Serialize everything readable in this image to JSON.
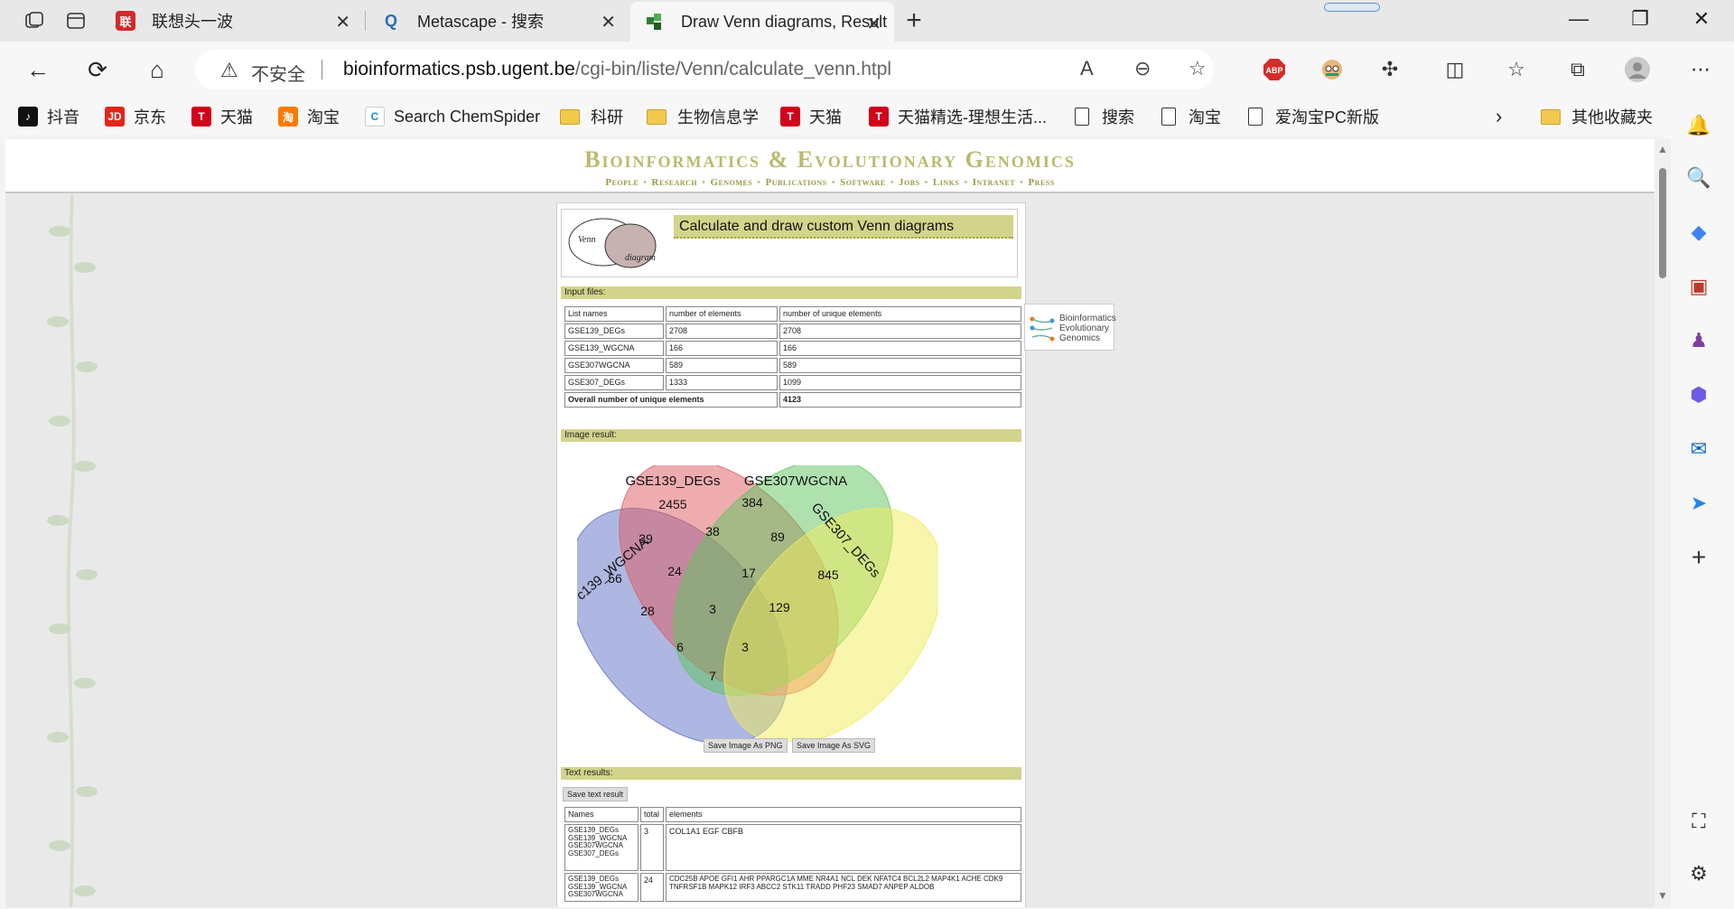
{
  "browser": {
    "tabs": [
      {
        "title": "联想头一波",
        "fav_text": "联",
        "fav_color": "#d42a2a"
      },
      {
        "title": "Metascape - 搜索",
        "fav_text": "Q",
        "fav_color": "#2b6cb0"
      },
      {
        "title": "Draw Venn diagrams, Result",
        "fav_text": "",
        "fav_color": "#2f7d32"
      }
    ],
    "address": {
      "insecure_label": "不安全",
      "host": "bioinformatics.psb.ugent.be",
      "path": "/cgi-bin/liste/Venn/calculate_venn.htpl"
    },
    "extensions": {
      "abp": "ABP"
    },
    "bookmarks": [
      {
        "label": "抖音",
        "kind": "icon",
        "icon": "tiktok-icon",
        "color": "#111111",
        "glyph": "♪"
      },
      {
        "label": "京东",
        "kind": "icon",
        "icon": "jd-icon",
        "color": "#e1251b",
        "glyph": "JD"
      },
      {
        "label": "天猫",
        "kind": "icon",
        "icon": "tmall-icon",
        "color": "#d3001b",
        "glyph": "T"
      },
      {
        "label": "淘宝",
        "kind": "icon",
        "icon": "taobao-icon",
        "color": "#ff7a00",
        "glyph": "淘"
      },
      {
        "label": "Search ChemSpider",
        "kind": "icon",
        "icon": "chemspider-icon",
        "color": "#ffffff",
        "glyph": "C"
      },
      {
        "label": "科研",
        "kind": "folder"
      },
      {
        "label": "生物信息学",
        "kind": "folder"
      },
      {
        "label": "天猫",
        "kind": "icon",
        "icon": "tmall-icon",
        "color": "#d3001b",
        "glyph": "T"
      },
      {
        "label": "天猫精选-理想生活...",
        "kind": "icon",
        "icon": "tmall-icon",
        "color": "#d3001b",
        "glyph": "T"
      },
      {
        "label": "搜索",
        "kind": "page"
      },
      {
        "label": "淘宝",
        "kind": "page"
      },
      {
        "label": "爱淘宝PC新版",
        "kind": "page"
      }
    ],
    "other_bookmarks": "其他收藏夹"
  },
  "site": {
    "title": "Bioinformatics & Evolutionary Genomics",
    "nav": [
      "People",
      "Research",
      "Genomes",
      "Publications",
      "Software",
      "Jobs",
      "Links",
      "Intranet",
      "Press"
    ],
    "beg_logo": [
      "Bioinformatics",
      "Evolutionary",
      "Genomics"
    ]
  },
  "page": {
    "heading": "Calculate and draw custom Venn diagrams",
    "logo_words": [
      "Venn",
      "diagram"
    ],
    "input_files_label": "Input files:",
    "input_table": {
      "headers": [
        "List names",
        "number of elements",
        "number of unique elements"
      ],
      "rows": [
        [
          "GSE139_DEGs",
          "2708",
          "2708"
        ],
        [
          "GSE139_WGCNA",
          "166",
          "166"
        ],
        [
          "GSE307WGCNA",
          "589",
          "589"
        ],
        [
          "GSE307_DEGs",
          "1333",
          "1099"
        ]
      ],
      "overall_label": "Overall number of unique elements",
      "overall_value": "4123"
    },
    "image_result_label": "Image result:",
    "save_png": "Save Image As PNG",
    "save_svg": "Save Image As SVG",
    "text_results_label": "Text results:",
    "save_text": "Save text result",
    "text_table": {
      "headers": [
        "Names",
        "total",
        "elements"
      ],
      "rows": [
        {
          "names": [
            "GSE139_DEGs",
            "GSE139_WGCNA",
            "GSE307WGCNA",
            "GSE307_DEGs"
          ],
          "total": "3",
          "elements": "COL1A1 EGF CBFB"
        },
        {
          "names": [
            "GSE139_DEGs",
            "GSE139_WGCNA",
            "GSE307WGCNA"
          ],
          "total": "24",
          "elements": "CDC25B APOE GFI1 AHR PPARGC1A MME NR4A1 NCL DEK NFATC4 BCL2L2 MAP4K1 ACHE CDK9 TNFRSF1B MAPK12 IRF3 ABCC2 STK11 TRADD PHF23 SMAD7 ANPEP ALDOB"
        }
      ]
    }
  },
  "chart_data": {
    "type": "venn",
    "sets": [
      {
        "name": "GSE139_WGCNA",
        "color": "#5b6fc4",
        "label_shown": "c139_WGCNA"
      },
      {
        "name": "GSE139_DEGs",
        "color": "#e05a5f"
      },
      {
        "name": "GSE307WGCNA",
        "color": "#5ec45e"
      },
      {
        "name": "GSE307_DEGs",
        "color": "#f2ec5a",
        "label_shown": "GSE307_DEGs"
      }
    ],
    "regions": [
      {
        "sets": [
          "GSE139_WGCNA"
        ],
        "value": 56
      },
      {
        "sets": [
          "GSE139_DEGs"
        ],
        "value": 2455
      },
      {
        "sets": [
          "GSE307WGCNA"
        ],
        "value": 384
      },
      {
        "sets": [
          "GSE307_DEGs"
        ],
        "value": 845
      },
      {
        "sets": [
          "GSE139_WGCNA",
          "GSE139_DEGs"
        ],
        "value": 39
      },
      {
        "sets": [
          "GSE139_DEGs",
          "GSE307WGCNA"
        ],
        "value": 38
      },
      {
        "sets": [
          "GSE307WGCNA",
          "GSE307_DEGs"
        ],
        "value": 89
      },
      {
        "sets": [
          "GSE139_WGCNA",
          "GSE139_DEGs",
          "GSE307WGCNA"
        ],
        "value": 24
      },
      {
        "sets": [
          "GSE139_DEGs",
          "GSE307WGCNA",
          "GSE307_DEGs"
        ],
        "value": 17
      },
      {
        "sets": [
          "GSE139_WGCNA",
          "GSE307WGCNA"
        ],
        "value": 28
      },
      {
        "sets": [
          "GSE139_WGCNA",
          "GSE139_DEGs",
          "GSE307WGCNA",
          "GSE307_DEGs"
        ],
        "value": 3
      },
      {
        "sets": [
          "GSE139_DEGs",
          "GSE307_DEGs"
        ],
        "value": 129
      },
      {
        "sets": [
          "GSE139_WGCNA",
          "GSE307WGCNA",
          "GSE307_DEGs"
        ],
        "value": 6
      },
      {
        "sets": [
          "GSE139_WGCNA",
          "GSE139_DEGs",
          "GSE307_DEGs"
        ],
        "value": 3
      },
      {
        "sets": [
          "GSE139_WGCNA",
          "GSE307_DEGs"
        ],
        "value": 7
      }
    ]
  }
}
